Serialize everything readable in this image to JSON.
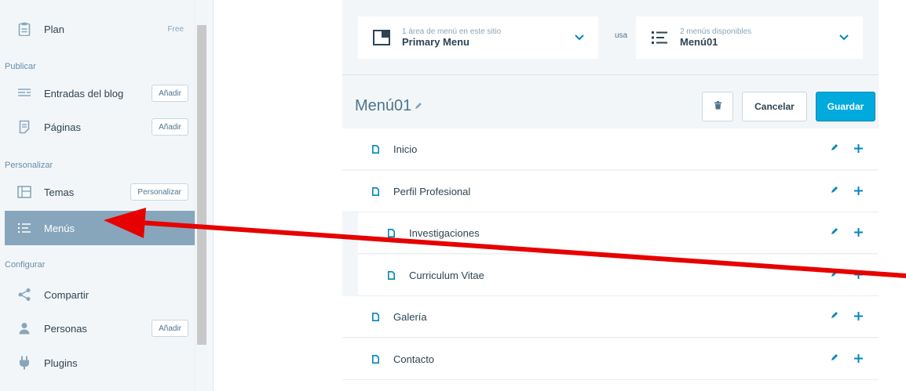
{
  "sidebar": {
    "plan": {
      "label": "Plan",
      "tag": "Free"
    },
    "publicar_header": "Publicar",
    "entradas": {
      "label": "Entradas del blog",
      "button": "Añadir"
    },
    "paginas": {
      "label": "Páginas",
      "button": "Añadir"
    },
    "personalizar_header": "Personalizar",
    "temas": {
      "label": "Temas",
      "button": "Personalizar"
    },
    "menus": {
      "label": "Menús"
    },
    "configurar_header": "Configurar",
    "compartir": {
      "label": "Compartir"
    },
    "personas": {
      "label": "Personas",
      "button": "Añadir"
    },
    "plugins": {
      "label": "Plugins"
    }
  },
  "location_select": {
    "small": "1 área de menú en este sitio",
    "value": "Primary Menu"
  },
  "usa_label": "usa",
  "menu_select": {
    "small": "2 menús disponibles",
    "value": "Menú01"
  },
  "menu_editor": {
    "title": "Menú01",
    "cancel_label": "Cancelar",
    "save_label": "Guardar",
    "items": [
      {
        "label": "Inicio",
        "level": 0
      },
      {
        "label": "Perfil Profesional",
        "level": 0
      },
      {
        "label": "Investigaciones",
        "level": 1
      },
      {
        "label": "Curriculum Vitae",
        "level": 1
      },
      {
        "label": "Galería",
        "level": 0
      },
      {
        "label": "Contacto",
        "level": 0
      }
    ]
  },
  "colors": {
    "accent": "#0087be",
    "save_button": "#00aadc",
    "active_sidebar": "#87a6bc",
    "annotation_arrow": "#e60000"
  }
}
